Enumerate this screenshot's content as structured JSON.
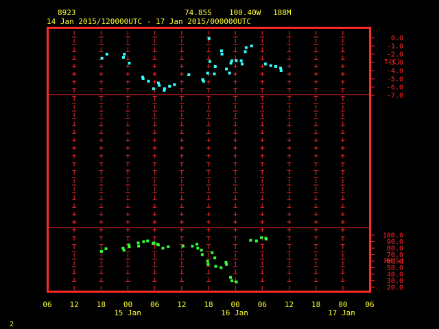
{
  "header": {
    "station": "8923",
    "lat": "74.85S",
    "lon": "100.40W",
    "elev": "188M",
    "time_range": "14 Jan 2015/120000UTC - 17 Jan 2015/000000UTC"
  },
  "footer": {
    "page_number": "2"
  },
  "colors": {
    "frame": "#ff2a2a",
    "text": "#ffff33",
    "temp": "#33ffff",
    "rh": "#33ff33"
  },
  "chart_data": [
    {
      "type": "scatter",
      "name": "temperature",
      "ylabel": "T(C)",
      "ylim": [
        -7.0,
        0.0
      ],
      "yticks": [
        "0.0",
        "-1.0",
        "-2.0",
        "-3.0",
        "-4.0",
        "-5.0",
        "-6.0",
        "-7.0"
      ],
      "x_unit": "hours since 14 Jan 2015 06UTC",
      "points": [
        {
          "x": 12.2,
          "y": -2.5
        },
        {
          "x": 13.3,
          "y": -2.0
        },
        {
          "x": 17.0,
          "y": -2.4
        },
        {
          "x": 17.2,
          "y": -2.0
        },
        {
          "x": 18.3,
          "y": -3.1
        },
        {
          "x": 21.3,
          "y": -4.8
        },
        {
          "x": 21.4,
          "y": -5.0
        },
        {
          "x": 22.6,
          "y": -5.3
        },
        {
          "x": 23.7,
          "y": -6.2
        },
        {
          "x": 24.8,
          "y": -5.5
        },
        {
          "x": 25.0,
          "y": -5.8
        },
        {
          "x": 26.1,
          "y": -6.4
        },
        {
          "x": 26.2,
          "y": -6.2
        },
        {
          "x": 27.3,
          "y": -5.9
        },
        {
          "x": 28.4,
          "y": -5.7
        },
        {
          "x": 31.6,
          "y": -4.5
        },
        {
          "x": 34.7,
          "y": -5.1
        },
        {
          "x": 34.9,
          "y": -5.3
        },
        {
          "x": 35.8,
          "y": -4.3
        },
        {
          "x": 36.1,
          "y": -0.1
        },
        {
          "x": 36.3,
          "y": -2.9
        },
        {
          "x": 37.3,
          "y": -4.4
        },
        {
          "x": 37.5,
          "y": -3.5
        },
        {
          "x": 38.9,
          "y": -1.6
        },
        {
          "x": 39.0,
          "y": -2.0
        },
        {
          "x": 40.0,
          "y": -3.8
        },
        {
          "x": 40.7,
          "y": -4.3
        },
        {
          "x": 41.0,
          "y": -3.1
        },
        {
          "x": 41.2,
          "y": -2.8
        },
        {
          "x": 42.2,
          "y": -2.8
        },
        {
          "x": 43.3,
          "y": -2.8
        },
        {
          "x": 43.5,
          "y": -3.2
        },
        {
          "x": 44.2,
          "y": -1.7
        },
        {
          "x": 44.4,
          "y": -1.2
        },
        {
          "x": 45.6,
          "y": -1.0
        },
        {
          "x": 48.7,
          "y": -3.2
        },
        {
          "x": 49.9,
          "y": -3.4
        },
        {
          "x": 51.0,
          "y": -3.5
        },
        {
          "x": 52.1,
          "y": -3.7
        },
        {
          "x": 52.2,
          "y": -4.0
        }
      ]
    },
    {
      "type": "scatter",
      "name": "relative_humidity",
      "ylabel": "RH(%)",
      "ylim": [
        20.0,
        100.0
      ],
      "yticks": [
        "100.0",
        "90.0",
        "80.0",
        "70.0",
        "60.0",
        "50.0",
        "40.0",
        "30.0",
        "20.0"
      ],
      "x_unit": "hours since 14 Jan 2015 06UTC",
      "points": [
        {
          "x": 12.1,
          "y": 75
        },
        {
          "x": 13.1,
          "y": 79
        },
        {
          "x": 16.9,
          "y": 80
        },
        {
          "x": 17.1,
          "y": 77
        },
        {
          "x": 18.2,
          "y": 85
        },
        {
          "x": 18.3,
          "y": 82
        },
        {
          "x": 20.3,
          "y": 88
        },
        {
          "x": 20.4,
          "y": 83
        },
        {
          "x": 21.5,
          "y": 90
        },
        {
          "x": 22.4,
          "y": 91
        },
        {
          "x": 23.6,
          "y": 87
        },
        {
          "x": 23.8,
          "y": 88
        },
        {
          "x": 24.6,
          "y": 86
        },
        {
          "x": 24.8,
          "y": 85
        },
        {
          "x": 25.8,
          "y": 80
        },
        {
          "x": 27.0,
          "y": 82
        },
        {
          "x": 30.3,
          "y": 83
        },
        {
          "x": 32.4,
          "y": 83
        },
        {
          "x": 33.4,
          "y": 86
        },
        {
          "x": 33.6,
          "y": 80
        },
        {
          "x": 34.4,
          "y": 77
        },
        {
          "x": 34.6,
          "y": 70
        },
        {
          "x": 35.8,
          "y": 60
        },
        {
          "x": 35.9,
          "y": 55
        },
        {
          "x": 36.8,
          "y": 73
        },
        {
          "x": 37.4,
          "y": 65
        },
        {
          "x": 37.6,
          "y": 52
        },
        {
          "x": 38.8,
          "y": 50
        },
        {
          "x": 39.9,
          "y": 58
        },
        {
          "x": 40.0,
          "y": 55
        },
        {
          "x": 40.9,
          "y": 35
        },
        {
          "x": 41.2,
          "y": 30
        },
        {
          "x": 42.2,
          "y": 28
        },
        {
          "x": 45.4,
          "y": 92
        },
        {
          "x": 46.7,
          "y": 91
        },
        {
          "x": 47.8,
          "y": 96
        },
        {
          "x": 48.8,
          "y": 95
        },
        {
          "x": 48.9,
          "y": 94
        }
      ]
    }
  ],
  "x_axis": {
    "tick_labels": [
      "06",
      "12",
      "18",
      "00",
      "06",
      "12",
      "18",
      "00",
      "06",
      "12",
      "18",
      "00",
      "06"
    ],
    "date_labels": [
      {
        "label": "15 Jan",
        "at": 18
      },
      {
        "label": "16 Jan",
        "at": 42
      },
      {
        "label": "17 Jan",
        "at": 66
      }
    ]
  }
}
